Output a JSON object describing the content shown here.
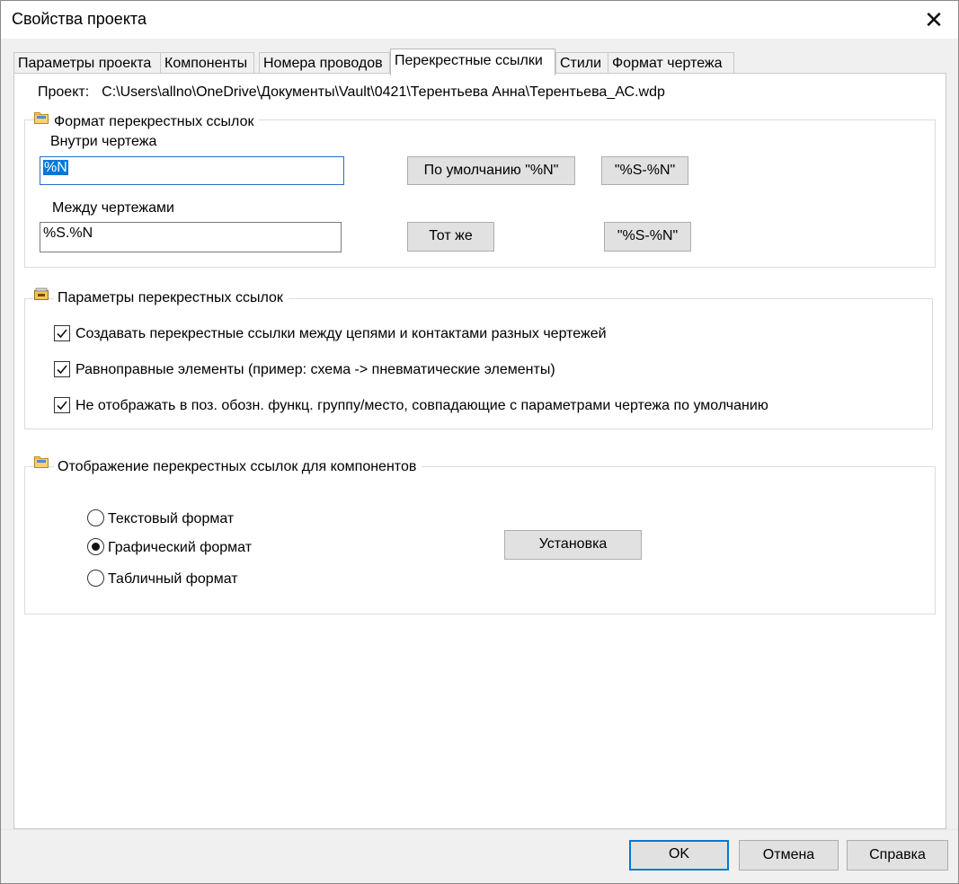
{
  "window": {
    "title": "Свойства проекта",
    "close_symbol": "✕"
  },
  "tabs": [
    {
      "label": "Параметры проекта",
      "active": false
    },
    {
      "label": "Компоненты",
      "active": false
    },
    {
      "label": "Номера проводов",
      "active": false
    },
    {
      "label": "Перекрестные ссылки",
      "active": true
    },
    {
      "label": "Стили",
      "active": false
    },
    {
      "label": "Формат чертежа",
      "active": false
    }
  ],
  "project": {
    "label": "Проект:",
    "path": "C:\\Users\\allno\\OneDrive\\Документы\\Vault\\0421\\Терентьева Анна\\Терентьева_АС.wdp"
  },
  "format_group": {
    "title": "Формат перекрестных ссылок",
    "icon": "folder-icon",
    "within_label": "Внутри чертежа",
    "within_value": "%N",
    "within_default_button": "По умолчанию \"%N\"",
    "within_alt_button": "\"%S-%N\"",
    "between_label": "Между чертежами",
    "between_value": "%S.%N",
    "between_same_button": "Тот же",
    "between_alt_button": "\"%S-%N\""
  },
  "params_group": {
    "title": "Параметры перекрестных ссылок",
    "icon": "settings-folder-icon",
    "options": [
      {
        "label": "Создавать перекрестные ссылки между цепями и контактами разных чертежей",
        "checked": true
      },
      {
        "label": "Равноправные элементы (пример: схема -> пневматические элементы)",
        "checked": true
      },
      {
        "label": "Не отображать в поз. обозн. функц. группу/место, совпадающие с параметрами чертежа по умолчанию",
        "checked": true
      }
    ]
  },
  "display_group": {
    "title": "Отображение перекрестных ссылок для компонентов",
    "icon": "folder-icon",
    "radios": [
      {
        "label": "Текстовый формат",
        "selected": false
      },
      {
        "label": "Графический формат",
        "selected": true
      },
      {
        "label": "Табличный формат",
        "selected": false
      }
    ],
    "setup_button": "Установка"
  },
  "footer": {
    "ok": "OK",
    "cancel": "Отмена",
    "help": "Справка"
  },
  "colors": {
    "accent": "#0078d7",
    "selection": "#0078d7",
    "button_face": "#e1e1e1",
    "dialog_bg": "#f0f0f0"
  }
}
